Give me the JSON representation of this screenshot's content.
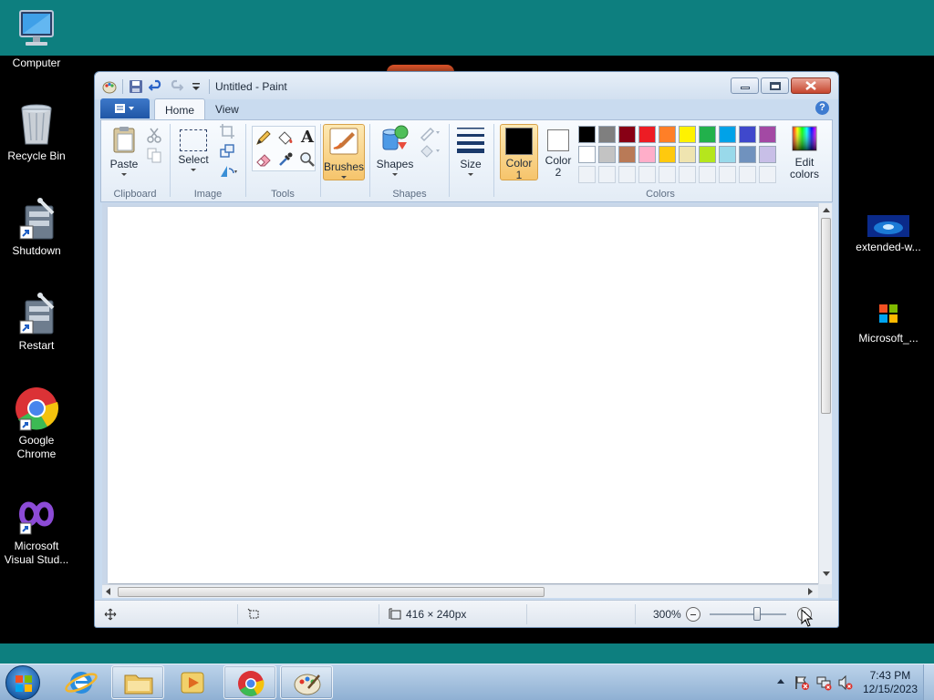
{
  "desktop": {
    "icons_left": [
      {
        "label": "Computer"
      },
      {
        "label": "Recycle Bin"
      },
      {
        "label": "Shutdown"
      },
      {
        "label": "Restart"
      },
      {
        "label": "Google Chrome"
      },
      {
        "label": "Microsoft Visual Stud..."
      }
    ],
    "icons_right": [
      {
        "label": "extended-w..."
      },
      {
        "label": "Microsoft_..."
      }
    ]
  },
  "window": {
    "title": "Untitled - Paint",
    "tabs": [
      {
        "label": "Home"
      },
      {
        "label": "View"
      }
    ],
    "help_glyph": "?"
  },
  "ribbon": {
    "groups": {
      "clipboard": "Clipboard",
      "image": "Image",
      "tools": "Tools",
      "shapes": "Shapes",
      "colors": "Colors"
    },
    "paste": "Paste",
    "select": "Select",
    "brushes": "Brushes",
    "shapes_btn": "Shapes",
    "size": "Size",
    "color1": {
      "line1": "Color",
      "line2": "1"
    },
    "color2": {
      "line1": "Color",
      "line2": "2"
    },
    "edit_colors": {
      "line1": "Edit",
      "line2": "colors"
    },
    "text_tool_glyph": "A"
  },
  "palette": {
    "row1": [
      "#000000",
      "#7f7f7f",
      "#880015",
      "#ed1c24",
      "#ff7f27",
      "#fff200",
      "#22b14c",
      "#00a2e8",
      "#3f48cc",
      "#a349a4"
    ],
    "row2": [
      "#ffffff",
      "#c3c3c3",
      "#b97a57",
      "#ffaec9",
      "#ffc90e",
      "#efe4b0",
      "#b5e61d",
      "#99d9ea",
      "#7092be",
      "#c8bfe7"
    ],
    "color1": "#000000",
    "color2": "#ffffff"
  },
  "status": {
    "dimensions": "416 × 240px",
    "zoom": "300%"
  },
  "taskbar": {
    "time": "7:43 PM",
    "date": "12/15/2023"
  }
}
